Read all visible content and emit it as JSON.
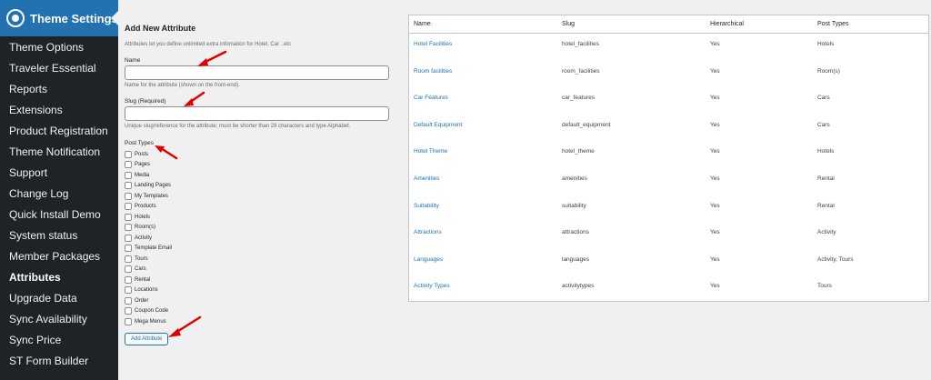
{
  "sidebar": {
    "header_title": "Theme Settings",
    "items": [
      {
        "label": "Theme Options",
        "active": false
      },
      {
        "label": "Traveler Essential",
        "active": false
      },
      {
        "label": "Reports",
        "active": false
      },
      {
        "label": "Extensions",
        "active": false
      },
      {
        "label": "Product Registration",
        "active": false
      },
      {
        "label": "Theme Notification",
        "active": false
      },
      {
        "label": "Support",
        "active": false
      },
      {
        "label": "Change Log",
        "active": false
      },
      {
        "label": "Quick Install Demo",
        "active": false
      },
      {
        "label": "System status",
        "active": false
      },
      {
        "label": "Member Packages",
        "active": false
      },
      {
        "label": "Attributes",
        "active": true
      },
      {
        "label": "Upgrade Data",
        "active": false
      },
      {
        "label": "Sync Availability",
        "active": false
      },
      {
        "label": "Sync Price",
        "active": false
      },
      {
        "label": "ST Form Builder",
        "active": false
      }
    ]
  },
  "form": {
    "title": "Add New Attribute",
    "intro": "Attributes let you define unlimited extra infomation for Hotel, Car ..etc",
    "name_label": "Name",
    "name_value": "",
    "name_desc": "Name for the attribute (shown on the front-end).",
    "slug_label": "Slug (Required)",
    "slug_value": "",
    "slug_desc": "Unique slug/reference for the attribute; must be shorter than 28 characters and type Alphabet.",
    "post_types_label": "Post Types",
    "post_types": [
      "Posts",
      "Pages",
      "Media",
      "Landing Pages",
      "My Templates",
      "Products",
      "Hotels",
      "Room(s)",
      "Activity",
      "Template Email",
      "Tours",
      "Cars",
      "Rental",
      "Locations",
      "Order",
      "Coupon Code",
      "Mega Menus"
    ],
    "submit_label": "Add Attribute"
  },
  "table": {
    "columns": [
      "Name",
      "Slug",
      "Hierarchical",
      "Post Types"
    ],
    "rows": [
      [
        "Hotel Facilities",
        "hotel_facilities",
        "Yes",
        "Hotels"
      ],
      [
        "Room facilities",
        "room_facilities",
        "Yes",
        "Room(s)"
      ],
      [
        "Car Features",
        "car_features",
        "Yes",
        "Cars"
      ],
      [
        "Default Equipment",
        "default_equipment",
        "Yes",
        "Cars"
      ],
      [
        "Hotel Theme",
        "hotel_theme",
        "Yes",
        "Hotels"
      ],
      [
        "Amenities",
        "amenities",
        "Yes",
        "Rental"
      ],
      [
        "Suitability",
        "suitability",
        "Yes",
        "Rental"
      ],
      [
        "Attractions",
        "attractions",
        "Yes",
        "Activity"
      ],
      [
        "Languages",
        "languages",
        "Yes",
        "Activity, Tours"
      ],
      [
        "Activity Types",
        "activitytypes",
        "Yes",
        "Tours"
      ]
    ]
  },
  "colors": {
    "sidebar_bg": "#1d2327",
    "accent": "#2271b1",
    "annotation_arrow": "#e00000"
  }
}
